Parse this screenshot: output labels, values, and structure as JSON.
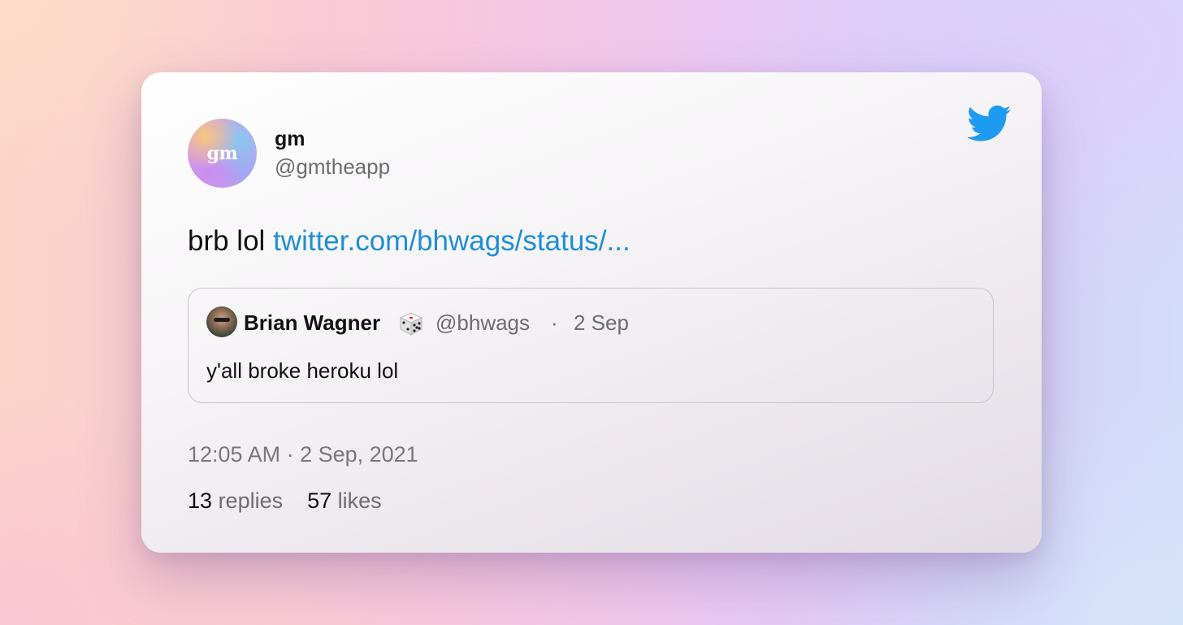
{
  "tweet": {
    "author": {
      "name": "gm",
      "handle": "@gmtheapp",
      "avatar_text": "gm"
    },
    "text": "brb lol",
    "link_text": "twitter.com/bhwags/status/...",
    "timestamp": "12:05 AM · 2 Sep, 2021",
    "stats": {
      "replies_count": "13",
      "replies_label": "replies",
      "likes_count": "57",
      "likes_label": "likes"
    },
    "quote": {
      "name": "Brian Wagner",
      "handle": "@bhwags",
      "separator": "·",
      "date": "2 Sep",
      "text": "y'all broke heroku lol"
    }
  },
  "icons": {
    "brand": "twitter-bird-icon",
    "emoji": "dice-icon"
  },
  "colors": {
    "link": "#1d8fd6",
    "twitter_blue": "#1d9bf0",
    "muted_text": "#6c6c72"
  }
}
